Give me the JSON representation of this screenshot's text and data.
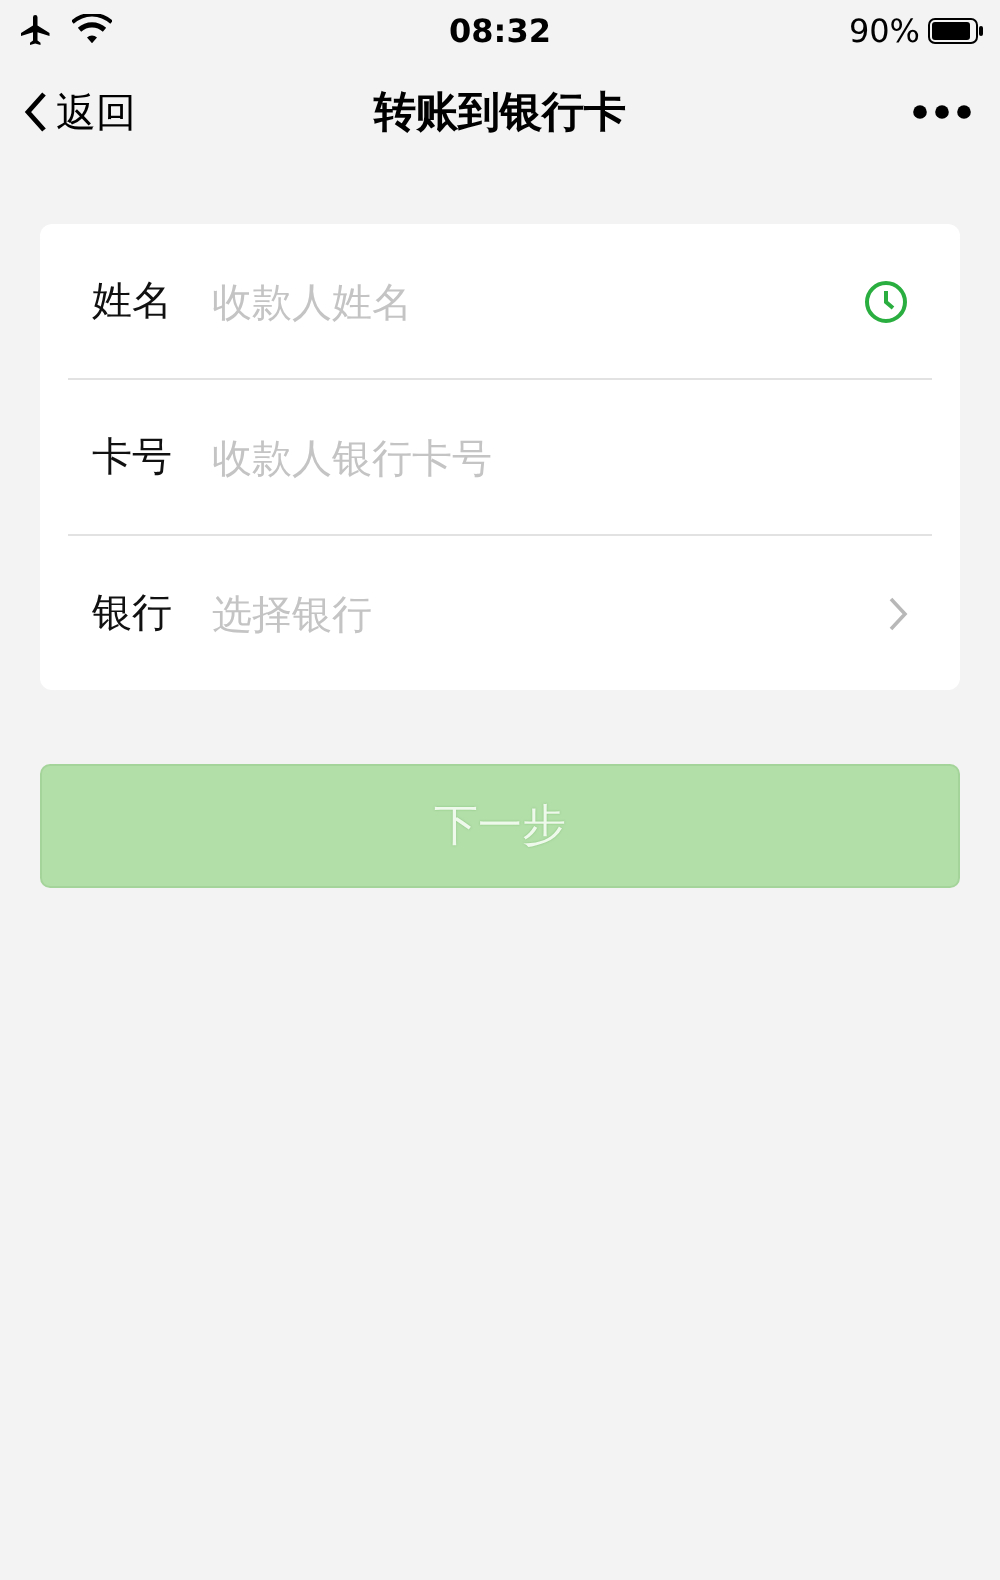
{
  "status_bar": {
    "time": "08:32",
    "battery": "90%"
  },
  "nav": {
    "back": "返回",
    "title": "转账到银行卡"
  },
  "form": {
    "rows": [
      {
        "label": "姓名",
        "placeholder": "收款人姓名",
        "kind": "history"
      },
      {
        "label": "卡号",
        "placeholder": "收款人银行卡号",
        "kind": "plain"
      },
      {
        "label": "银行",
        "placeholder": "选择银行",
        "kind": "select"
      }
    ]
  },
  "next_button": {
    "label": "下一步",
    "disabled": true
  }
}
